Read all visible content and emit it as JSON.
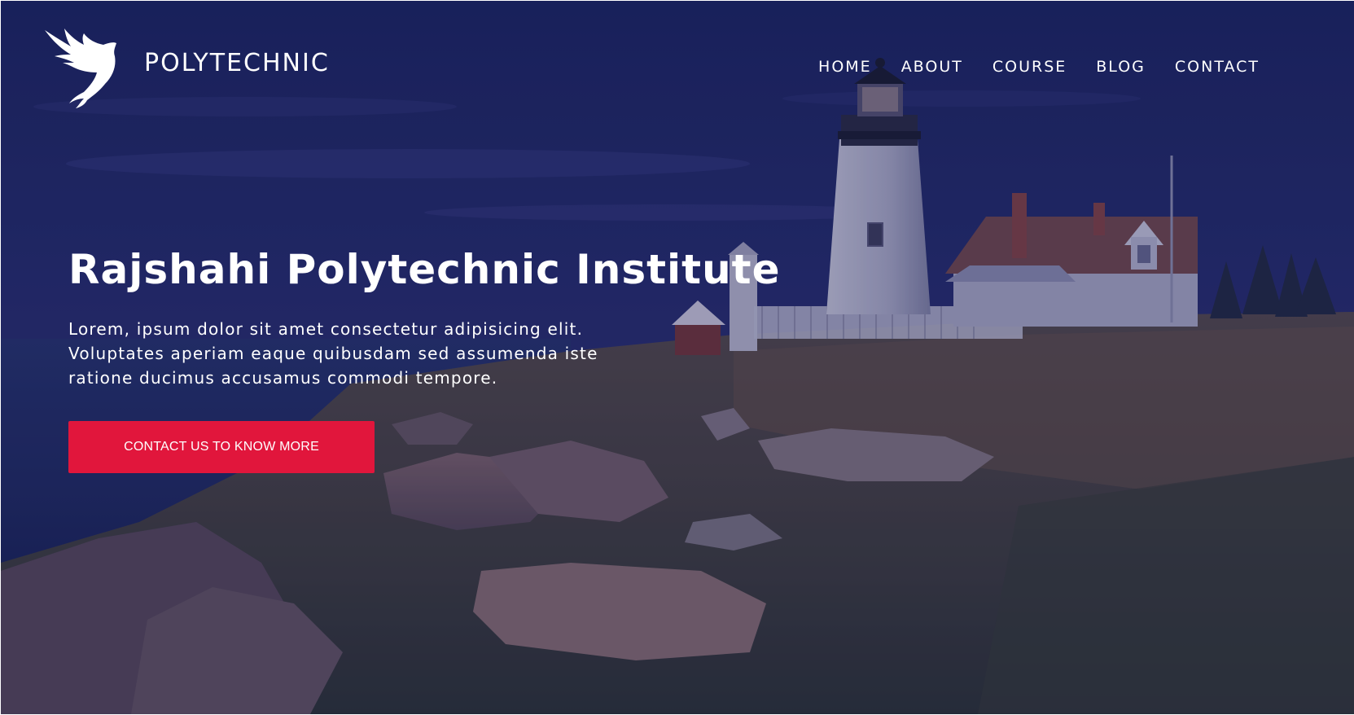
{
  "brand": {
    "name": "POLYTECHNIC"
  },
  "nav": {
    "items": [
      {
        "label": "HOME"
      },
      {
        "label": "ABOUT"
      },
      {
        "label": "COURSE"
      },
      {
        "label": "BLOG"
      },
      {
        "label": "CONTACT"
      }
    ]
  },
  "hero": {
    "title": "Rajshahi Polytechnic Institute",
    "description": "Lorem, ipsum dolor sit amet consectetur adipisicing elit. Voluptates aperiam eaque quibusdam sed assumenda iste ratione ducimus accusamus commodi tempore.",
    "cta_label": "CONTACT US TO KNOW MORE",
    "overlay_color": "#1b2366",
    "cta_color": "#e1163c"
  }
}
